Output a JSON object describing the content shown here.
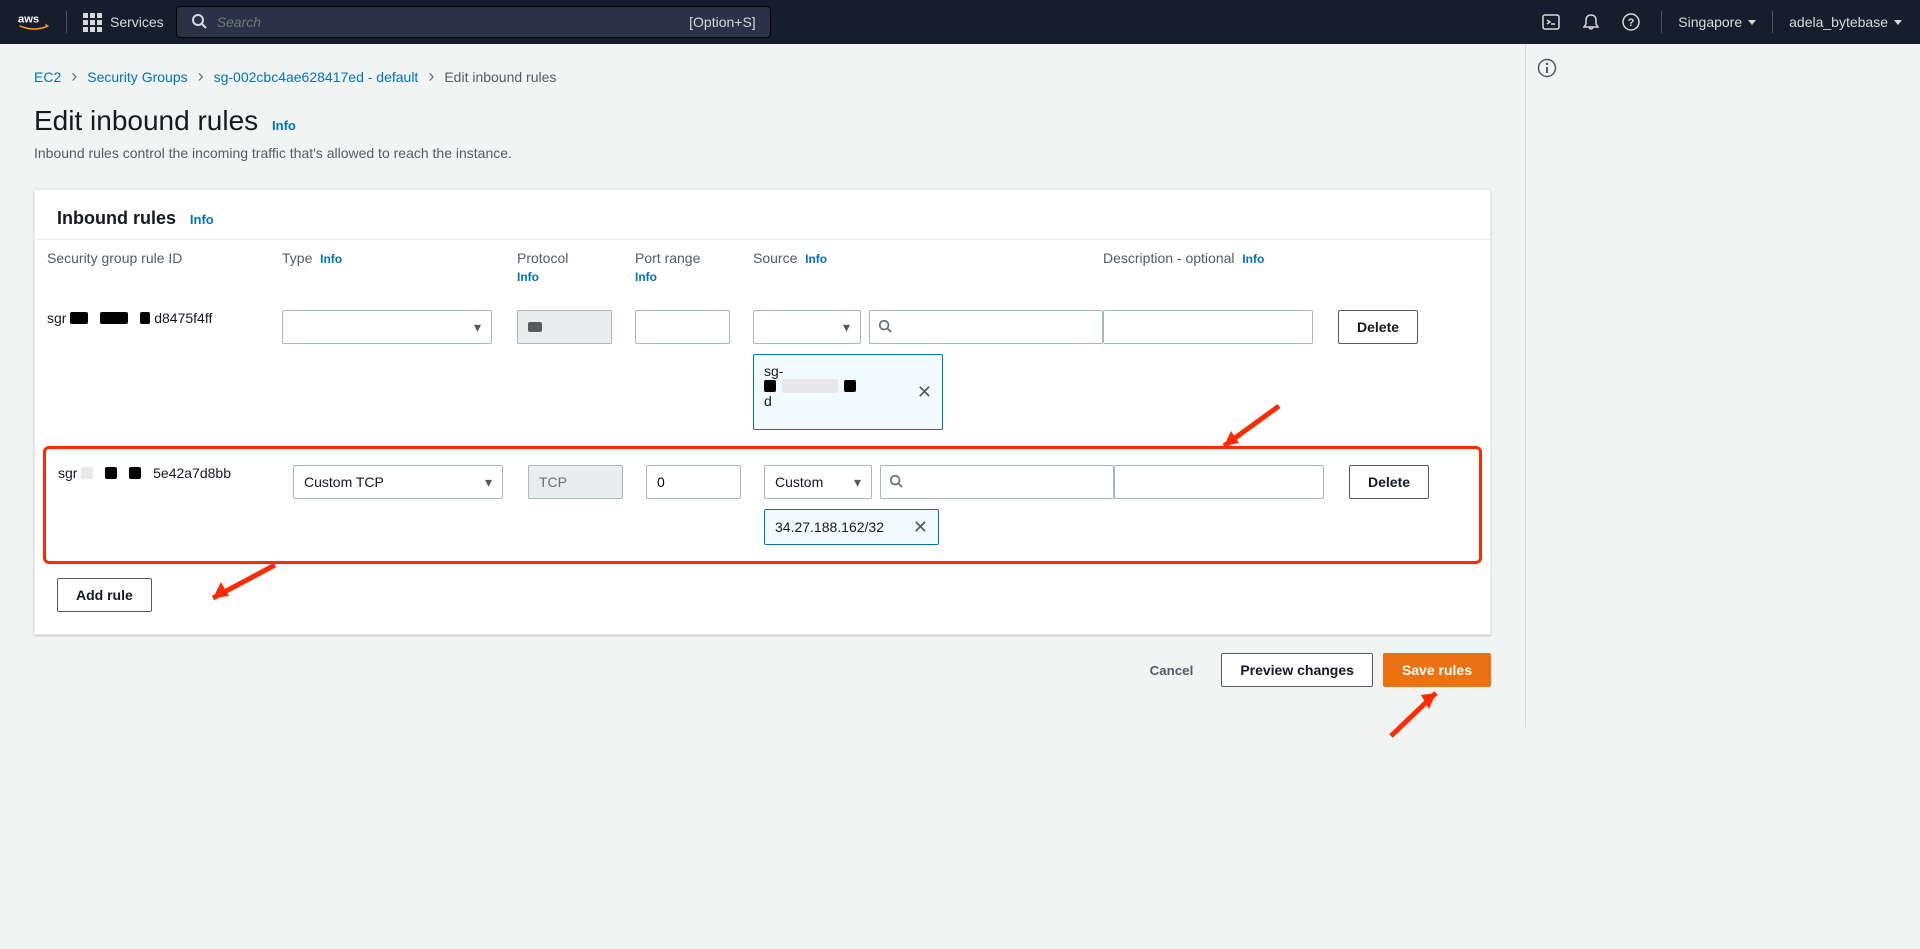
{
  "topnav": {
    "services_label": "Services",
    "search_placeholder": "Search",
    "search_hint": "[Option+S]",
    "region": "Singapore",
    "user": "adela_bytebase"
  },
  "breadcrumb": {
    "items": [
      {
        "label": "EC2"
      },
      {
        "label": "Security Groups"
      },
      {
        "label": "sg-002cbc4ae628417ed - default"
      }
    ],
    "current": "Edit inbound rules"
  },
  "page": {
    "title": "Edit inbound rules",
    "info": "Info",
    "subtitle": "Inbound rules control the incoming traffic that's allowed to reach the instance."
  },
  "panel": {
    "title": "Inbound rules",
    "info": "Info",
    "columns": {
      "rule_id": "Security group rule ID",
      "type": "Type",
      "protocol": "Protocol",
      "port": "Port range",
      "source": "Source",
      "desc": "Description - optional"
    },
    "col_info": "Info",
    "add_rule": "Add rule"
  },
  "rules": [
    {
      "id_prefix": "sgr",
      "id_suffix": "d8475f4ff",
      "type": "",
      "protocol": "",
      "port": "",
      "source_select": "",
      "source_search": "",
      "source_tag_top": "sg-",
      "source_tag_bottom": "d",
      "desc": "",
      "delete": "Delete"
    },
    {
      "id_prefix": "sgr",
      "id_suffix": "5e42a7d8bb",
      "type": "Custom TCP",
      "protocol": "TCP",
      "port": "0",
      "source_select": "Custom",
      "source_search": "",
      "source_tag": "34.27.188.162/32",
      "desc": "",
      "delete": "Delete"
    }
  ],
  "actions": {
    "cancel": "Cancel",
    "preview": "Preview changes",
    "save": "Save rules"
  }
}
